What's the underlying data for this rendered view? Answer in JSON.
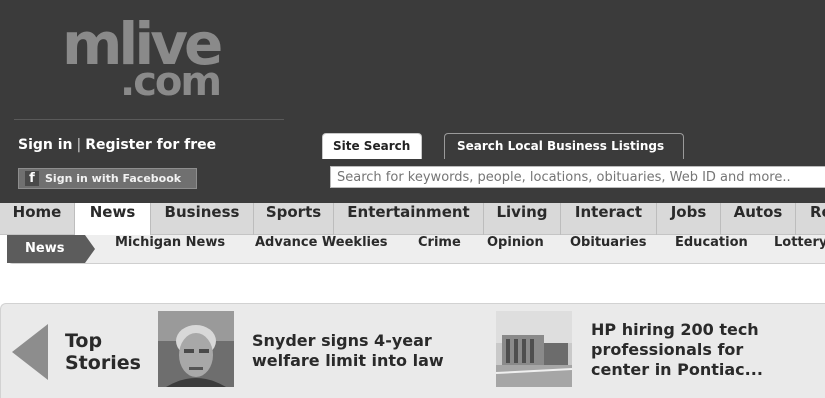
{
  "logo": {
    "line1": "mlive",
    "line2": ".com"
  },
  "account": {
    "sign_in": "Sign in",
    "separator": "|",
    "register": "Register for free",
    "facebook_icon_glyph": "f",
    "facebook_button": "Sign in with Facebook"
  },
  "search": {
    "tabs": [
      "Site Search",
      "Search Local Business Listings"
    ],
    "placeholder": "Search for keywords, people, locations, obituaries, Web ID and more.."
  },
  "main_nav": {
    "active": "News",
    "items": [
      "Home",
      "News",
      "Business",
      "Sports",
      "Entertainment",
      "Living",
      "Interact",
      "Jobs",
      "Autos",
      "Re"
    ]
  },
  "sub_nav": {
    "active": "News",
    "items": [
      "Michigan News",
      "Advance Weeklies",
      "Crime",
      "Opinion",
      "Obituaries",
      "Education",
      "Lottery"
    ]
  },
  "top_stories": {
    "label_line1": "Top",
    "label_line2": "Stories",
    "stories": [
      {
        "title_line1": "Snyder signs 4-year",
        "title_line2": "welfare limit into law",
        "thumb_icon": "man-portrait-photo"
      },
      {
        "title_line1": "HP hiring 200 tech",
        "title_line2": "professionals for",
        "title_line3": "center in Pontiac...",
        "thumb_icon": "office-building-photo"
      }
    ]
  },
  "colors": {
    "header_bg": "#3b3b3b",
    "nav_bg": "#d9d9d9",
    "subnav_active_bg": "#5c5c5c",
    "stories_bg": "#eaeaea"
  }
}
